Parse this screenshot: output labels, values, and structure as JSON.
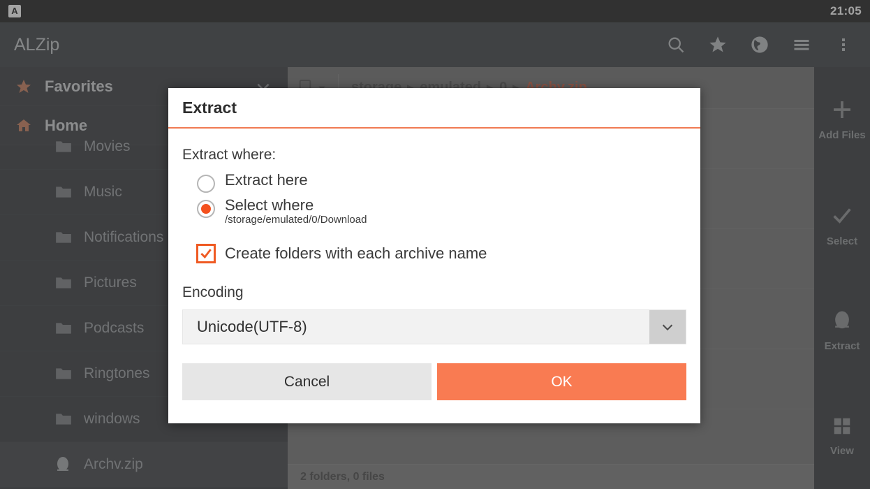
{
  "system": {
    "app_icon_glyph": "A",
    "clock": "21:05"
  },
  "appbar": {
    "title": "ALZip",
    "actions": [
      {
        "name": "search-icon",
        "label": "Search"
      },
      {
        "name": "star-icon",
        "label": "Favorites"
      },
      {
        "name": "globe-icon",
        "label": "Network"
      },
      {
        "name": "hamburger-icon",
        "label": "Menu"
      },
      {
        "name": "overflow-icon",
        "label": "More options"
      }
    ]
  },
  "drawer": {
    "favorites": {
      "label": "Favorites",
      "icon": "star-icon",
      "collapse_icon": "chevron-down-icon"
    },
    "home": {
      "label": "Home",
      "icon": "home-icon"
    },
    "items": [
      {
        "label": "Movies",
        "icon": "folder-icon",
        "selected": false
      },
      {
        "label": "Music",
        "icon": "folder-icon",
        "selected": false
      },
      {
        "label": "Notifications",
        "icon": "folder-icon",
        "selected": false
      },
      {
        "label": "Pictures",
        "icon": "folder-icon",
        "selected": false
      },
      {
        "label": "Podcasts",
        "icon": "folder-icon",
        "selected": false
      },
      {
        "label": "Ringtones",
        "icon": "folder-icon",
        "selected": false
      },
      {
        "label": "windows",
        "icon": "folder-icon",
        "selected": false
      },
      {
        "label": "Archv.zip",
        "icon": "archive-icon",
        "selected": true
      }
    ]
  },
  "content": {
    "device_icon": "storage-device-icon",
    "breadcrumbs": [
      {
        "label": "storage",
        "current": false
      },
      {
        "label": "emulated",
        "current": false
      },
      {
        "label": "0",
        "current": false
      },
      {
        "label": "Archv.zip",
        "current": true
      }
    ],
    "separator": "▶",
    "status": "2 folders, 0 files"
  },
  "rail": {
    "items": [
      {
        "label": "Add Files",
        "icon": "plus-icon"
      },
      {
        "label": "Select",
        "icon": "check-icon"
      },
      {
        "label": "Extract",
        "icon": "extract-icon"
      },
      {
        "label": "View",
        "icon": "grid-view-icon"
      }
    ]
  },
  "dialog": {
    "title": "Extract",
    "where_label": "Extract where:",
    "options": [
      {
        "label": "Extract here",
        "sub": "",
        "selected": false
      },
      {
        "label": "Select where",
        "sub": "/storage/emulated/0/Download",
        "selected": true
      }
    ],
    "checkbox": {
      "label": "Create folders with each archive name",
      "checked": true
    },
    "encoding_label": "Encoding",
    "encoding_value": "Unicode(UTF-8)",
    "encoding_arrow_icon": "chevron-down-icon",
    "cancel_label": "Cancel",
    "ok_label": "OK"
  },
  "colors": {
    "accent_orange": "#f97b52",
    "radio_orange": "#f4511e",
    "checkbox_orange": "#ef5a23",
    "breadcrumb_current": "#c0492a",
    "dialog_rule": "#f07a52"
  }
}
